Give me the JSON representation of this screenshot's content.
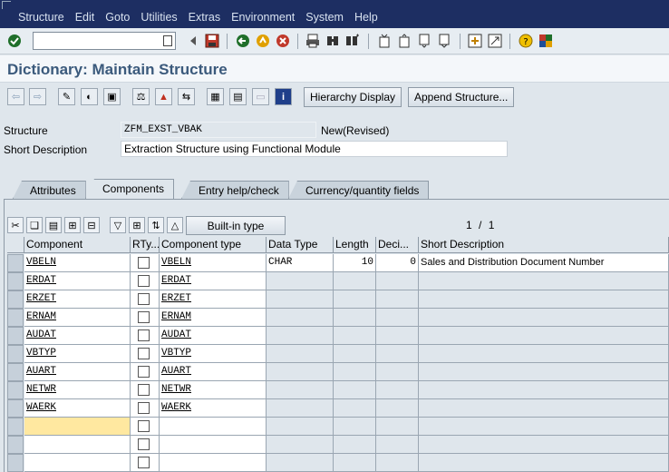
{
  "menubar": {
    "items": [
      "Structure",
      "Edit",
      "Goto",
      "Utilities",
      "Extras",
      "Environment",
      "System",
      "Help"
    ]
  },
  "toolbar": {
    "command_value": "",
    "icons": [
      "enter-icon",
      "back-arrow-icon",
      "save-icon",
      "back-icon",
      "exit-icon",
      "cancel-icon",
      "print-icon",
      "find-icon",
      "find-next-icon",
      "first-page-icon",
      "prev-page-icon",
      "next-page-icon",
      "last-page-icon",
      "new-session-icon",
      "shortcut-icon",
      "help-icon",
      "customize-layout-icon"
    ]
  },
  "title": "Dictionary: Maintain Structure",
  "appbar": {
    "hierarchy_display": "Hierarchy Display",
    "append_structure": "Append Structure..."
  },
  "header": {
    "structure_label": "Structure",
    "structure_value": "ZFM_EXST_VBAK",
    "status": "New(Revised)",
    "short_desc_label": "Short Description",
    "short_desc_value": "Extraction Structure using Functional Module"
  },
  "tabs": [
    "Attributes",
    "Components",
    "Entry help/check",
    "Currency/quantity fields"
  ],
  "active_tab": "Components",
  "table_toolbar": {
    "builtin_type": "Built-in type",
    "page": "1",
    "page_sep": "/",
    "page_total": "1"
  },
  "table": {
    "columns": [
      "Component",
      "RTy...",
      "Component type",
      "Data Type",
      "Length",
      "Deci...",
      "Short Description"
    ],
    "rows": [
      {
        "component": "VBELN",
        "comptype": "VBELN",
        "datatype": "CHAR",
        "length": "10",
        "decimals": "0",
        "desc": "Sales and Distribution Document Number"
      },
      {
        "component": "ERDAT",
        "comptype": "ERDAT",
        "datatype": "",
        "length": "",
        "decimals": "",
        "desc": ""
      },
      {
        "component": "ERZET",
        "comptype": "ERZET",
        "datatype": "",
        "length": "",
        "decimals": "",
        "desc": ""
      },
      {
        "component": "ERNAM",
        "comptype": "ERNAM",
        "datatype": "",
        "length": "",
        "decimals": "",
        "desc": ""
      },
      {
        "component": "AUDAT",
        "comptype": "AUDAT",
        "datatype": "",
        "length": "",
        "decimals": "",
        "desc": ""
      },
      {
        "component": "VBTYP",
        "comptype": "VBTYP",
        "datatype": "",
        "length": "",
        "decimals": "",
        "desc": ""
      },
      {
        "component": "AUART",
        "comptype": "AUART",
        "datatype": "",
        "length": "",
        "decimals": "",
        "desc": ""
      },
      {
        "component": "NETWR",
        "comptype": "NETWR",
        "datatype": "",
        "length": "",
        "decimals": "",
        "desc": ""
      },
      {
        "component": "WAERK",
        "comptype": "WAERK",
        "datatype": "",
        "length": "",
        "decimals": "",
        "desc": ""
      },
      {
        "component": "",
        "comptype": "",
        "datatype": "",
        "length": "",
        "decimals": "",
        "desc": ""
      },
      {
        "component": "",
        "comptype": "",
        "datatype": "",
        "length": "",
        "decimals": "",
        "desc": ""
      },
      {
        "component": "",
        "comptype": "",
        "datatype": "",
        "length": "",
        "decimals": "",
        "desc": ""
      }
    ]
  }
}
